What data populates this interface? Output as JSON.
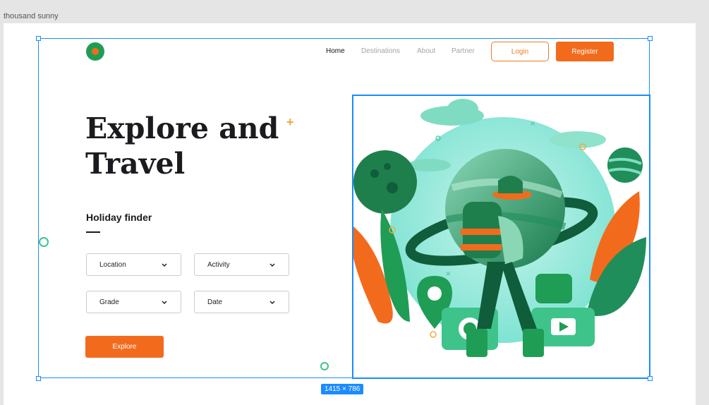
{
  "canvas": {
    "frame_name": "thousand sunny",
    "dimensions_badge": "1415 × 786"
  },
  "nav": {
    "items": [
      {
        "label": "Home",
        "active": true
      },
      {
        "label": "Destinations",
        "active": false
      },
      {
        "label": "About",
        "active": false
      },
      {
        "label": "Partner",
        "active": false
      }
    ],
    "login_label": "Login",
    "register_label": "Register"
  },
  "hero": {
    "title_line1": "Explore and",
    "title_line2": "Travel"
  },
  "finder": {
    "title": "Holiday finder",
    "fields": [
      {
        "label": "Location"
      },
      {
        "label": "Activity"
      },
      {
        "label": "Grade"
      },
      {
        "label": "Date"
      }
    ],
    "explore_label": "Explore"
  },
  "colors": {
    "accent_orange": "#f26b1d",
    "brand_green": "#1f9d55",
    "selection_blue": "#1a8cff"
  },
  "icons": [
    "logo-icon",
    "chevron-down-icon",
    "plus-icon",
    "hiker-illustration"
  ]
}
